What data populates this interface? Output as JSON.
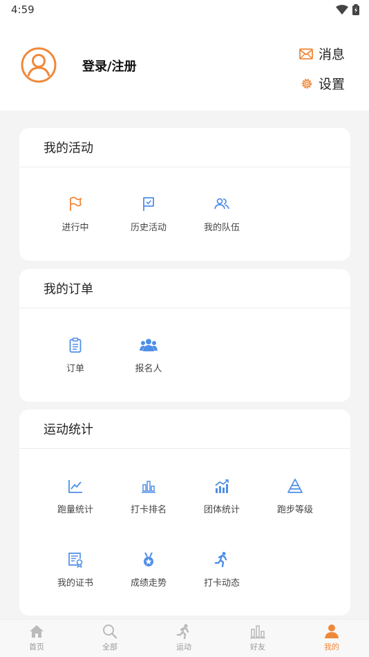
{
  "status_bar": {
    "time": "4:59"
  },
  "header": {
    "login_label": "登录/注册",
    "messages_label": "消息",
    "settings_label": "设置"
  },
  "activities": {
    "title": "我的活动",
    "items": [
      {
        "label": "进行中",
        "icon": "flag-icon"
      },
      {
        "label": "历史活动",
        "icon": "flag-check-icon"
      },
      {
        "label": "我的队伍",
        "icon": "team-icon"
      }
    ]
  },
  "orders": {
    "title": "我的订单",
    "items": [
      {
        "label": "订单",
        "icon": "order-clipboard-icon"
      },
      {
        "label": "报名人",
        "icon": "registrants-icon"
      }
    ]
  },
  "stats": {
    "title": "运动统计",
    "items": [
      {
        "label": "跑量统计",
        "icon": "line-chart-icon"
      },
      {
        "label": "打卡排名",
        "icon": "bar-chart-icon"
      },
      {
        "label": "团体统计",
        "icon": "trend-bars-icon"
      },
      {
        "label": "跑步等级",
        "icon": "pyramid-icon"
      },
      {
        "label": "我的证书",
        "icon": "certificate-icon"
      },
      {
        "label": "成绩走势",
        "icon": "medal-icon"
      },
      {
        "label": "打卡动态",
        "icon": "runner-icon"
      }
    ]
  },
  "tabbar": {
    "items": [
      {
        "label": "首页",
        "icon": "home-icon"
      },
      {
        "label": "全部",
        "icon": "search-icon"
      },
      {
        "label": "运动",
        "icon": "runner-icon"
      },
      {
        "label": "好友",
        "icon": "bar-chart-icon"
      },
      {
        "label": "我的",
        "icon": "profile-icon"
      }
    ],
    "active_index": 4
  },
  "colors": {
    "accent": "#f0883a",
    "icon_blue": "#4f8fe8",
    "page_bg": "#f4f4f4"
  }
}
